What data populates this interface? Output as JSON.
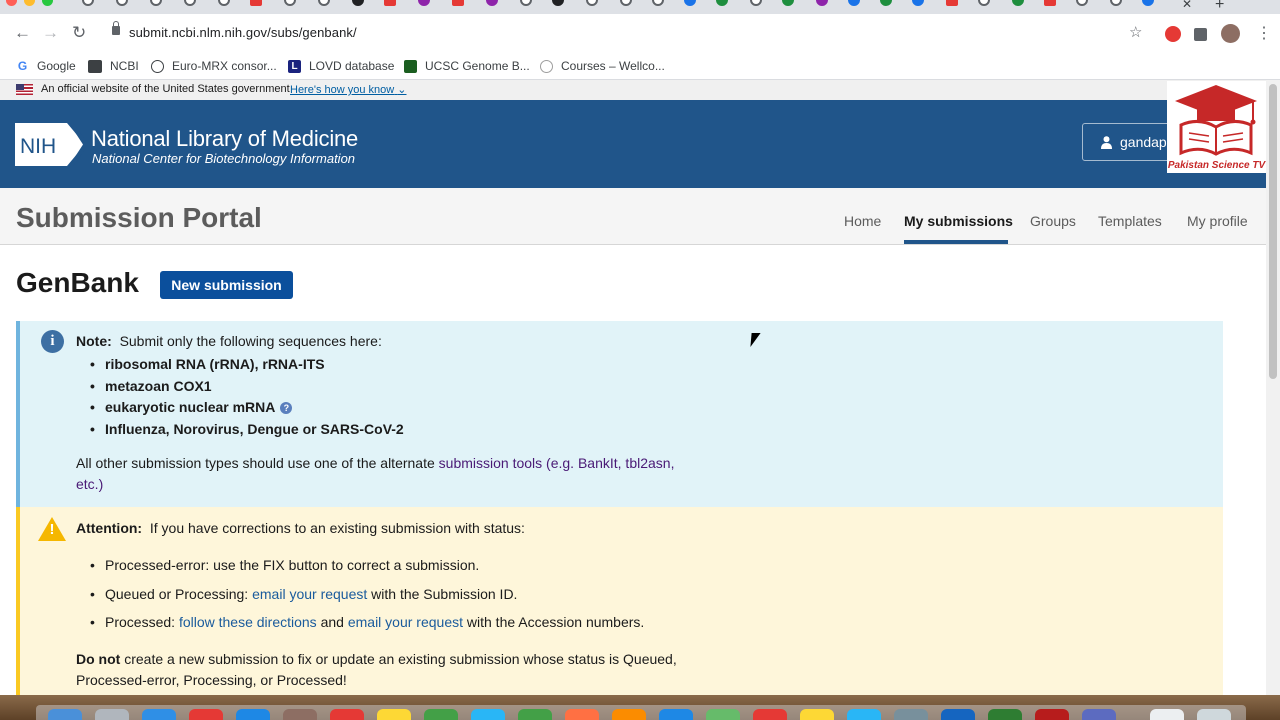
{
  "browser": {
    "url": "submit.ncbi.nlm.nih.gov/subs/genbank/",
    "bookmarks": [
      {
        "label": "Google",
        "icon": "google-icon"
      },
      {
        "label": "NCBI",
        "icon": "ncbi-icon"
      },
      {
        "label": "Euro-MRX consor...",
        "icon": "globe-icon"
      },
      {
        "label": "LOVD database",
        "icon": "lovd-icon"
      },
      {
        "label": "UCSC Genome B...",
        "icon": "ucsc-icon"
      },
      {
        "label": "Courses – Wellco...",
        "icon": "courses-icon"
      }
    ]
  },
  "gov_banner": {
    "text": "An official website of the United States government",
    "link": "Here's how you know"
  },
  "header": {
    "logo_text": "NIH",
    "title": "National Library of Medicine",
    "subtitle": "National Center for Biotechnology Information",
    "user": "gandap"
  },
  "watermark": {
    "text": "Pakistan Science TV"
  },
  "portal": {
    "title": "Submission Portal",
    "nav": [
      "Home",
      "My submissions",
      "Groups",
      "Templates",
      "My profile"
    ],
    "active_nav": "My submissions"
  },
  "main": {
    "title": "GenBank",
    "new_button": "New submission"
  },
  "note": {
    "label": "Note:",
    "intro": "Submit only the following sequences here:",
    "items": [
      "ribosomal RNA (rRNA), rRNA-ITS",
      "metazoan COX1",
      "eukaryotic nuclear mRNA",
      "Influenza, Norovirus, Dengue or SARS-CoV-2"
    ],
    "other_prefix": "All other submission types should use one of the alternate",
    "other_link": "submission tools (e.g. BankIt, tbl2asn,",
    "other_link2": "etc.)"
  },
  "attention": {
    "label": "Attention:",
    "intro": "If you have corrections to an existing submission with status:",
    "item1": "Processed-error: use the FIX button to correct a submission.",
    "item2_prefix": "Queued or Processing:",
    "item2_link": "email your request",
    "item2_suffix": "with the Submission ID.",
    "item3_prefix": "Processed:",
    "item3_link1": "follow these directions",
    "item3_mid": "and",
    "item3_link2": "email your request",
    "item3_suffix": "with the Accession numbers.",
    "footer_bold": "Do not",
    "footer_line1": "create a new submission to fix or update an existing submission whose status is Queued,",
    "footer_line2": "Processed-error, Processing, or Processed!"
  },
  "colors": {
    "header_bg": "#20558a",
    "note_bg": "#e1f3f8",
    "attention_bg": "#fef6da",
    "button_bg": "#0b4f9c"
  }
}
